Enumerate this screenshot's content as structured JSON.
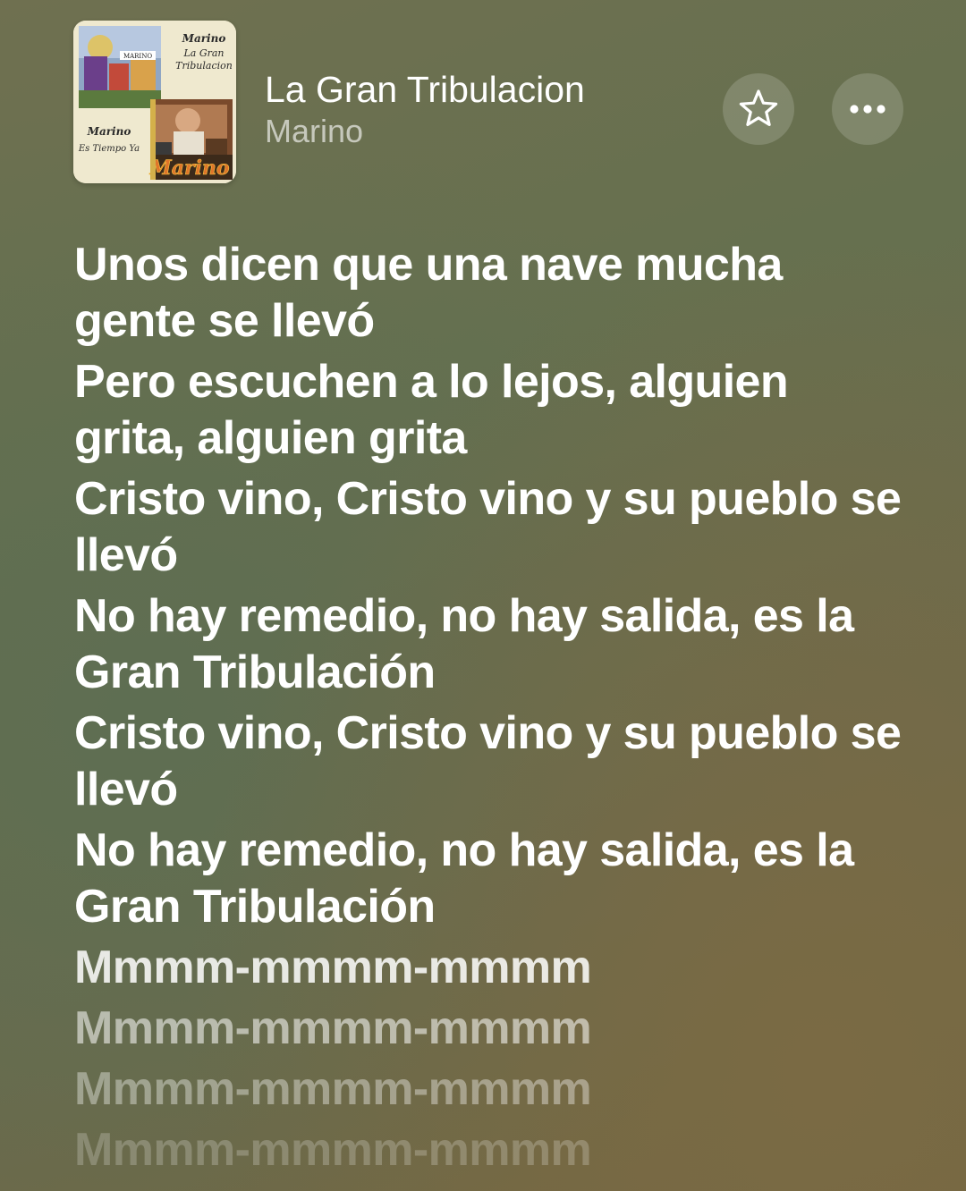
{
  "now_playing": {
    "title": "La Gran Tribulacion",
    "artist": "Marino",
    "artwork_text": {
      "top_artist": "Marino",
      "top_title_line1": "La Gran",
      "top_title_line2": "Tribulacion",
      "bottom_artist": "Marino",
      "bottom_title": "Es Tiempo Ya",
      "sign": "MARINO",
      "logo": "Marino"
    }
  },
  "actions": {
    "favorite_icon": "star-outline-icon",
    "more_icon": "ellipsis-icon"
  },
  "lyrics": [
    "Unos dicen que una nave mucha gente se llevó",
    "Pero escuchen a lo lejos, alguien grita, alguien grita",
    "Cristo vino, Cristo vino y su pueblo se llevó",
    "No hay remedio, no hay salida, es la Gran Tribulación",
    "Cristo vino, Cristo vino y su pueblo se llevó",
    "No hay remedio, no hay salida, es la Gran Tribulación",
    "Mmmm-mmmm-mmmm",
    "Mmmm-mmmm-mmmm",
    "Mmmm-mmmm-mmmm",
    "Mmmm-mmmm-mmmm"
  ]
}
